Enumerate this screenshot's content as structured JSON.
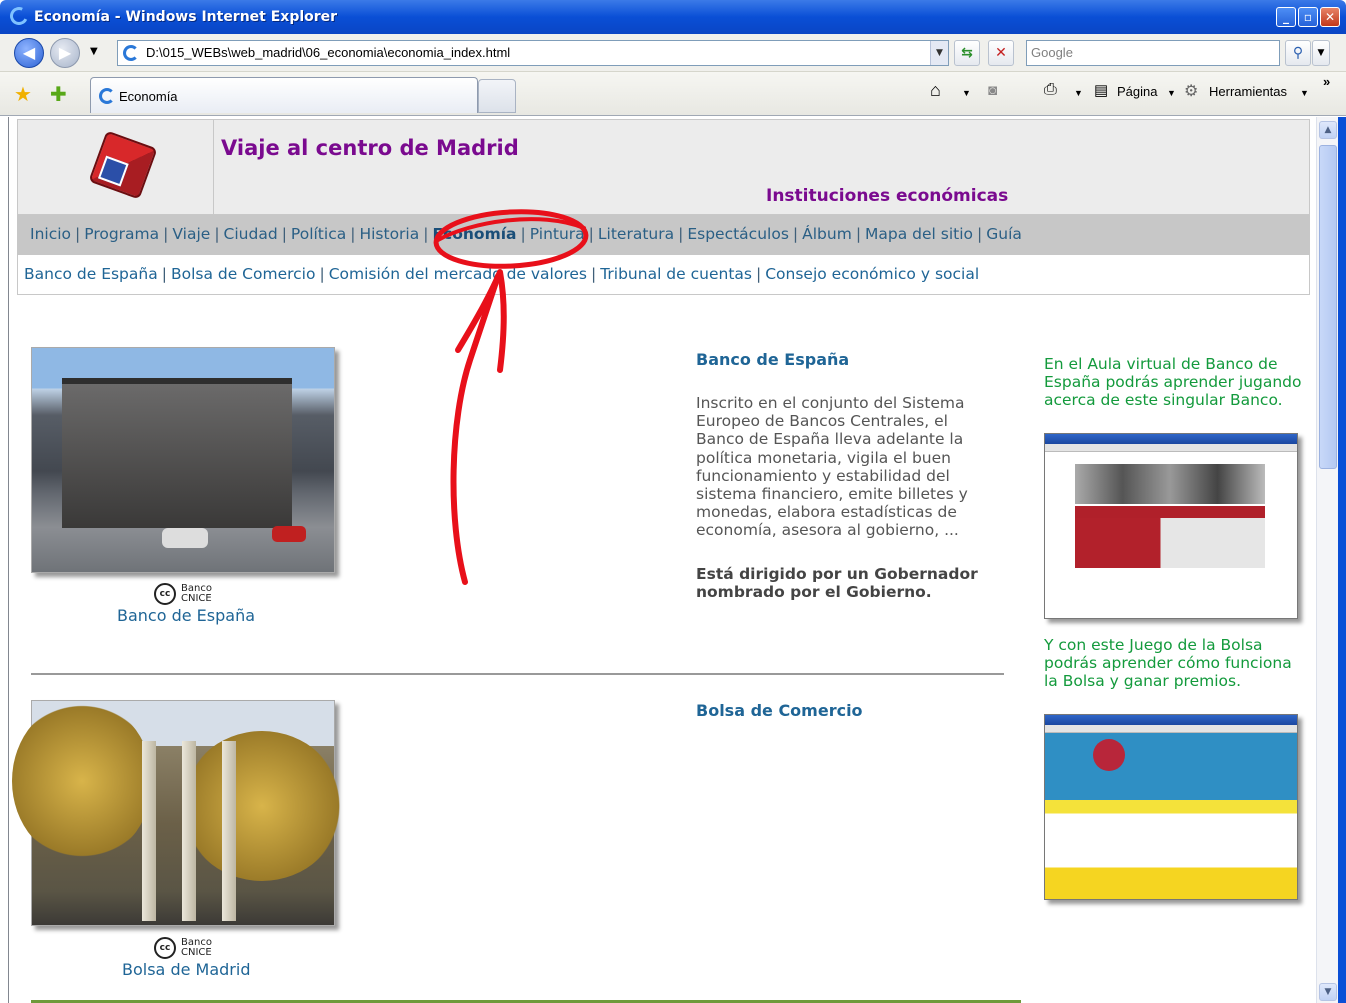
{
  "window": {
    "title": "Economía - Windows Internet Explorer"
  },
  "browser": {
    "address": "D:\\015_WEBs\\web_madrid\\06_economia\\economia_index.html",
    "search_placeholder": "Google",
    "tab_title": "Economía",
    "page_label": "Página",
    "tools_label": "Herramientas"
  },
  "page": {
    "site_title": "Viaje al centro de Madrid",
    "section_title": "Instituciones económicas",
    "main_nav": [
      {
        "label": "Inicio"
      },
      {
        "label": "Programa"
      },
      {
        "label": "Viaje"
      },
      {
        "label": "Ciudad"
      },
      {
        "label": "Política"
      },
      {
        "label": "Historia"
      },
      {
        "label": "Economía",
        "active": true
      },
      {
        "label": "Pintura"
      },
      {
        "label": "Literatura"
      },
      {
        "label": "Espectáculos"
      },
      {
        "label": "Álbum"
      },
      {
        "label": "Mapa del sitio"
      },
      {
        "label": "Guía"
      }
    ],
    "sub_nav": [
      {
        "label": "Banco de España"
      },
      {
        "label": "Bolsa de Comercio"
      },
      {
        "label": "Comisión del mercado de valores"
      },
      {
        "label": "Tribunal de cuentas"
      },
      {
        "label": "Consejo económico y social"
      }
    ],
    "credit": {
      "line1": "Banco",
      "line2": "CNICE"
    },
    "sections": [
      {
        "caption": "Banco de España",
        "title": "Banco de España",
        "text": "Inscrito en el conjunto del Sistema Europeo de Bancos Centrales, el Banco de España lleva adelante la política monetaria, vigila el buen funcionamiento y estabilidad del sistema financiero, emite billetes y monedas, elabora estadísticas de economía, asesora al gobierno, ...",
        "bold": "Está dirigido por un Gobernador nombrado por el Gobierno."
      },
      {
        "caption": "Bolsa de Madrid",
        "title": "Bolsa de Comercio"
      }
    ],
    "sidebar": [
      {
        "text": "En el Aula virtual de Banco de España podrás aprender jugando acerca de este singular Banco."
      },
      {
        "text": "Y con este Juego de la Bolsa podrás aprender cómo funciona la Bolsa y ganar premios."
      }
    ]
  },
  "colors": {
    "title_purple": "#7a0a8f",
    "link_blue": "#1f6596",
    "sidebar_green": "#139a3c",
    "annotation_red": "#e8101a"
  }
}
